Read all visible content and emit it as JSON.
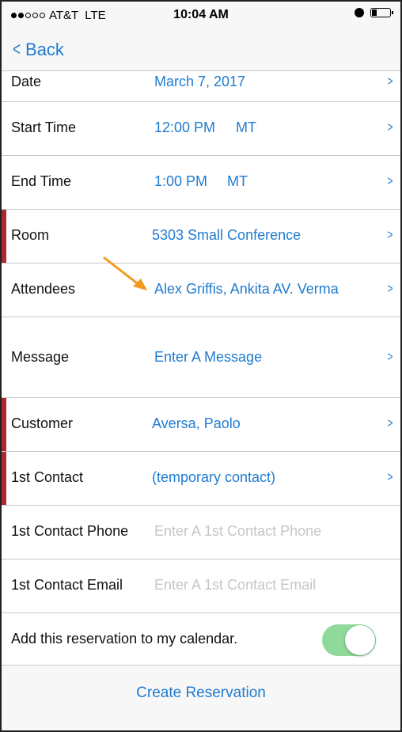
{
  "status_bar": {
    "carrier": "AT&T",
    "network": "LTE",
    "time": "10:04 AM",
    "signal_bars_filled": 2,
    "signal_bars_total": 5
  },
  "nav": {
    "back_label": "Back"
  },
  "rows": {
    "date": {
      "label": "Date",
      "value": "March 7, 2017"
    },
    "start_time": {
      "label": "Start Time",
      "value": "12:00 PM",
      "zone": "MT"
    },
    "end_time": {
      "label": "End Time",
      "value": "1:00 PM",
      "zone": "MT"
    },
    "room": {
      "label": "Room",
      "value": "5303 Small Conference"
    },
    "attendees": {
      "label": "Attendees",
      "value": "Alex Griffis, Ankita AV. Verma"
    },
    "message": {
      "label": "Message",
      "value": "Enter A Message"
    },
    "customer": {
      "label": "Customer",
      "value": "Aversa, Paolo"
    },
    "first_contact": {
      "label": "1st Contact",
      "value": "(temporary contact)"
    },
    "first_contact_phone": {
      "label": "1st Contact Phone",
      "placeholder": "Enter A 1st Contact Phone"
    },
    "first_contact_email": {
      "label": "1st Contact Email",
      "placeholder": "Enter A 1st Contact Email"
    },
    "calendar": {
      "label": "Add this reservation to my calendar.",
      "enabled": true
    }
  },
  "footer": {
    "create_label": "Create Reservation"
  },
  "colors": {
    "accent": "#1f7bd1",
    "required_marker": "#b0282f",
    "toggle_on": "#8fd99a",
    "annotation_arrow": "#f29a1f"
  }
}
